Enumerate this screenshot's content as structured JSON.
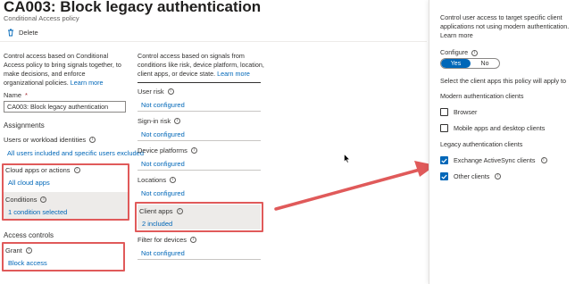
{
  "header": {
    "title": "CA003: Block legacy authentication",
    "more": "···",
    "subtitle": "Conditional Access policy",
    "delete_label": "Delete"
  },
  "left_col": {
    "description": "Control access based on Conditional Access policy to bring signals together, to make decisions, and enforce organizational policies.",
    "learn_more": "Learn more",
    "name_label": "Name",
    "name_required": "*",
    "name_value": "CA003: Block legacy authentication",
    "assignments_heading": "Assignments",
    "users_label": "Users or workload identities",
    "users_value": "All users included and specific users excluded",
    "cloud_apps_label": "Cloud apps or actions",
    "cloud_apps_value": "All cloud apps",
    "conditions_label": "Conditions",
    "conditions_value": "1 condition selected",
    "access_controls_heading": "Access controls",
    "grant_label": "Grant",
    "grant_value": "Block access"
  },
  "mid_col": {
    "description": "Control access based on signals from conditions like risk, device platform, location, client apps, or device state.",
    "learn_more": "Learn more",
    "items": [
      {
        "label": "User risk",
        "value": "Not configured"
      },
      {
        "label": "Sign-in risk",
        "value": "Not configured"
      },
      {
        "label": "Device platforms",
        "value": "Not configured"
      },
      {
        "label": "Locations",
        "value": "Not configured"
      },
      {
        "label": "Client apps",
        "value": "2 included"
      },
      {
        "label": "Filter for devices",
        "value": "Not configured"
      }
    ]
  },
  "panel": {
    "intro_line1": "Control user access to target specific client",
    "intro_line2": "applications not using modern authentication.",
    "learn_more": "Learn more",
    "configure_label": "Configure",
    "toggle_yes": "Yes",
    "toggle_no": "No",
    "select_text": "Select the client apps this policy will apply to",
    "modern_heading": "Modern authentication clients",
    "browser": "Browser",
    "mobile": "Mobile apps and desktop clients",
    "legacy_heading": "Legacy authentication clients",
    "exchange": "Exchange ActiveSync clients",
    "other": "Other clients"
  },
  "colors": {
    "accent": "#0067b8",
    "highlight_red": "#e05a5a",
    "selected_gray": "#edebe9"
  }
}
